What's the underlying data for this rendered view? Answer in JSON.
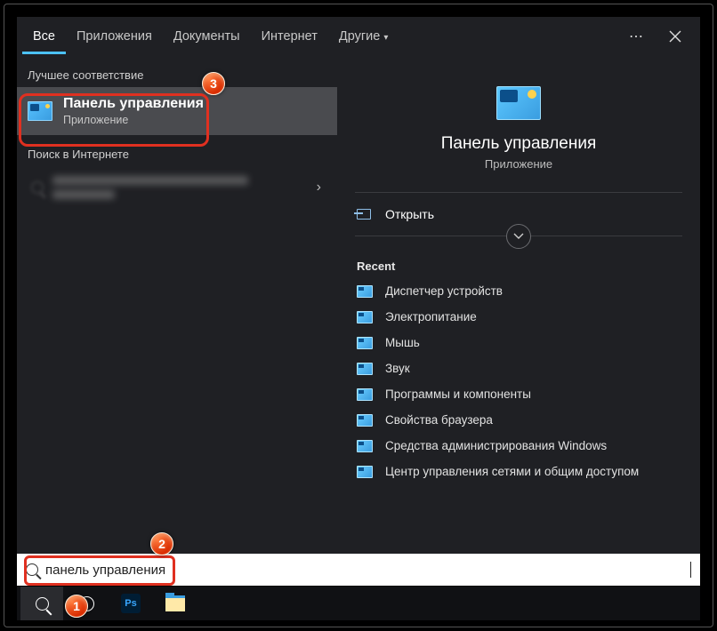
{
  "tabs": {
    "all": "Все",
    "apps": "Приложения",
    "docs": "Документы",
    "web": "Интернет",
    "more": "Другие"
  },
  "sections": {
    "best_match": "Лучшее соответствие",
    "web_search": "Поиск в Интернете"
  },
  "result": {
    "title": "Панель управления",
    "subtitle": "Приложение"
  },
  "preview": {
    "title": "Панель управления",
    "subtitle": "Приложение",
    "open": "Открыть",
    "recent_label": "Recent",
    "recent": [
      "Диспетчер устройств",
      "Электропитание",
      "Мышь",
      "Звук",
      "Программы и компоненты",
      "Свойства браузера",
      "Средства администрирования Windows",
      "Центр управления сетями и общим доступом"
    ]
  },
  "search": {
    "value": "панель управления"
  },
  "taskbar": {
    "ps": "Ps"
  },
  "markers": {
    "m1": "1",
    "m2": "2",
    "m3": "3"
  }
}
